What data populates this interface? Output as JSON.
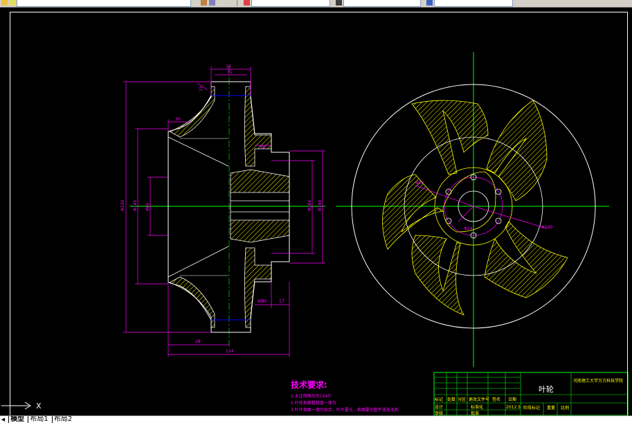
{
  "toolbar": {
    "combo_1": "",
    "combo_2": "",
    "combo_3": ""
  },
  "dimensions": {
    "left_view": [
      "36",
      "31",
      "30",
      "80",
      "60",
      "80",
      "17",
      "28",
      "114",
      "Φ230",
      "Φ145",
      "Φ60",
      "Φ164",
      "Φ140",
      "15"
    ],
    "right_view": [
      "Φ20",
      "Φ24",
      "Φ140"
    ]
  },
  "notes": {
    "heading": "技术要求:",
    "lines": [
      "1.未注倒角均为1X45°",
      "2.叶轮表面粗糙度一律为",
      "3.叶片表面一律为拟合，叶片要光，表面要光整平滑无毛刺"
    ]
  },
  "title_block": {
    "part_name": "叶轮",
    "school": "河南理工大学万方科技学院",
    "row1": [
      "标记",
      "处数",
      "分区",
      "更改文件号",
      "签名",
      "日期"
    ],
    "row2": [
      "设计",
      "",
      "标准化",
      "2012.5"
    ],
    "row3": [
      "审核",
      "",
      "批准"
    ],
    "stage": "阶段标记",
    "weight": "重量",
    "scale": "比例"
  },
  "ucs": {
    "x_label": "X"
  },
  "tabs": [
    "模型",
    "布局1",
    "布局2"
  ],
  "colors": {
    "background": "#000000",
    "outline": "#ffffff",
    "dimension": "#ff00ff",
    "centerline": "#00ff00",
    "hatch": "#ffff00",
    "hidden": "#0000ff"
  }
}
